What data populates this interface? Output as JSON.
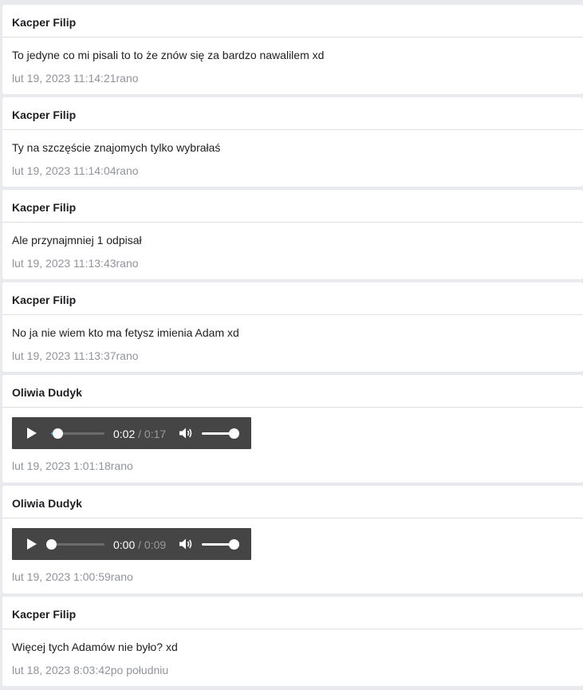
{
  "messages": [
    {
      "sender": "Kacper Filip",
      "type": "text",
      "text": "To jedyne co mi pisali to to że znów się za bardzo nawalilem xd",
      "timestamp": "lut 19, 2023 11:14:21rano"
    },
    {
      "sender": "Kacper Filip",
      "type": "text",
      "text": "Ty na szczęście znajomych tylko wybrałaś",
      "timestamp": "lut 19, 2023 11:14:04rano"
    },
    {
      "sender": "Kacper Filip",
      "type": "text",
      "text": "Ale przynajmniej 1 odpisał",
      "timestamp": "lut 19, 2023 11:13:43rano"
    },
    {
      "sender": "Kacper Filip",
      "type": "text",
      "text": "No ja nie wiem kto ma fetysz imienia Adam xd",
      "timestamp": "lut 19, 2023 11:13:37rano"
    },
    {
      "sender": "Oliwia Dudyk",
      "type": "audio",
      "current_time": "0:02",
      "separator": " / ",
      "duration": "0:17",
      "progress_fraction": 0.12,
      "volume_fraction": 1.0,
      "timestamp": "lut 19, 2023 1:01:18rano"
    },
    {
      "sender": "Oliwia Dudyk",
      "type": "audio",
      "current_time": "0:00",
      "separator": " / ",
      "duration": "0:09",
      "progress_fraction": 0.0,
      "volume_fraction": 1.0,
      "timestamp": "lut 19, 2023 1:00:59rano"
    },
    {
      "sender": "Kacper Filip",
      "type": "text",
      "text": "Więcej tych Adamów nie było? xd",
      "timestamp": "lut 18, 2023 8:03:42po południu"
    }
  ],
  "colors": {
    "page_bg": "#e9eaed",
    "card_bg": "#ffffff",
    "text": "#1c1e21",
    "timestamp": "#90949c",
    "player_bg": "#454545",
    "progress": "#1fb0e0"
  },
  "icons": {
    "play": "play-icon",
    "volume": "volume-icon"
  }
}
